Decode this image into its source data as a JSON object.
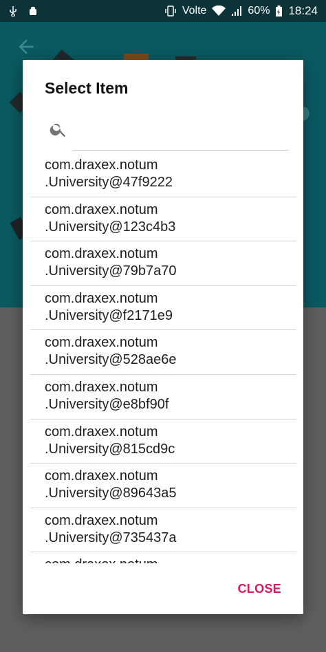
{
  "status_bar": {
    "lte_label": "Volte",
    "battery": "60%",
    "time": "18:24"
  },
  "dialog": {
    "title": "Select Item",
    "search": {
      "value": "",
      "placeholder": ""
    },
    "items": [
      {
        "line1": "com.draxex.notum",
        "line2": ".University@47f9222"
      },
      {
        "line1": "com.draxex.notum",
        "line2": ".University@123c4b3"
      },
      {
        "line1": "com.draxex.notum",
        "line2": ".University@79b7a70"
      },
      {
        "line1": "com.draxex.notum",
        "line2": ".University@f2171e9"
      },
      {
        "line1": "com.draxex.notum",
        "line2": ".University@528ae6e"
      },
      {
        "line1": "com.draxex.notum",
        "line2": ".University@e8bf90f"
      },
      {
        "line1": "com.draxex.notum",
        "line2": ".University@815cd9c"
      },
      {
        "line1": "com.draxex.notum",
        "line2": ".University@89643a5"
      },
      {
        "line1": "com.draxex.notum",
        "line2": ".University@735437a"
      },
      {
        "line1": "com.draxex.notum",
        "line2": ""
      }
    ],
    "close_label": "CLOSE"
  },
  "colors": {
    "accent": "#d81b60",
    "app_bar": "#0a5a61",
    "status_bar": "#0c3438"
  }
}
